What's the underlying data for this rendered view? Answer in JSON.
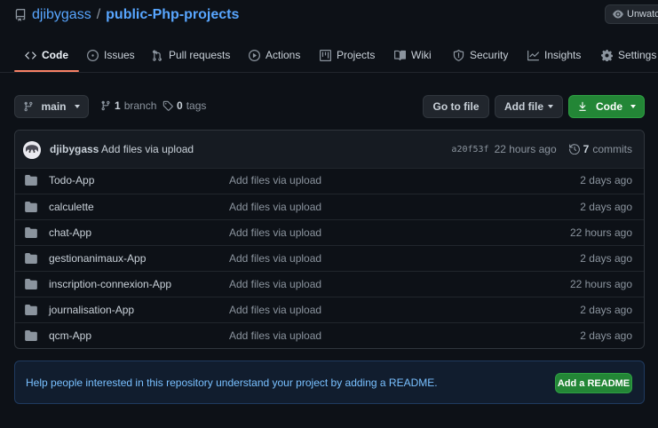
{
  "repo": {
    "owner": "djibygass",
    "separator": "/",
    "name": "public-Php-projects",
    "watch_label": "Unwatch"
  },
  "tabs": [
    {
      "label": "Code",
      "icon": "code-icon",
      "active": true
    },
    {
      "label": "Issues",
      "icon": "issue-icon"
    },
    {
      "label": "Pull requests",
      "icon": "pull-request-icon"
    },
    {
      "label": "Actions",
      "icon": "play-icon"
    },
    {
      "label": "Projects",
      "icon": "project-icon"
    },
    {
      "label": "Wiki",
      "icon": "book-icon"
    },
    {
      "label": "Security",
      "icon": "shield-icon"
    },
    {
      "label": "Insights",
      "icon": "graph-icon"
    },
    {
      "label": "Settings",
      "icon": "gear-icon"
    }
  ],
  "toolbar": {
    "branch_button": "main",
    "branch_count": "1",
    "branch_word": "branch",
    "tag_count": "0",
    "tag_word": "tags",
    "go_to_file": "Go to file",
    "add_file": "Add file",
    "code_button": "Code"
  },
  "latest_commit": {
    "author": "djibygass",
    "message": "Add files via upload",
    "sha": "a20f53f",
    "time": "22 hours ago",
    "commit_count": "7",
    "commit_word": "commits"
  },
  "files": [
    {
      "name": "Todo-App",
      "message": "Add files via upload",
      "age": "2 days ago"
    },
    {
      "name": "calculette",
      "message": "Add files via upload",
      "age": "2 days ago"
    },
    {
      "name": "chat-App",
      "message": "Add files via upload",
      "age": "22 hours ago"
    },
    {
      "name": "gestionanimaux-App",
      "message": "Add files via upload",
      "age": "2 days ago"
    },
    {
      "name": "inscription-connexion-App",
      "message": "Add files via upload",
      "age": "22 hours ago"
    },
    {
      "name": "journalisation-App",
      "message": "Add files via upload",
      "age": "2 days ago"
    },
    {
      "name": "qcm-App",
      "message": "Add files via upload",
      "age": "2 days ago"
    }
  ],
  "readme_banner": {
    "text": "Help people interested in this repository understand your project by adding a README.",
    "button": "Add a README"
  },
  "colors": {
    "accent_blue": "#58a6ff",
    "green": "#238636",
    "tab_underline": "#f78166",
    "background": "#0d1117"
  }
}
